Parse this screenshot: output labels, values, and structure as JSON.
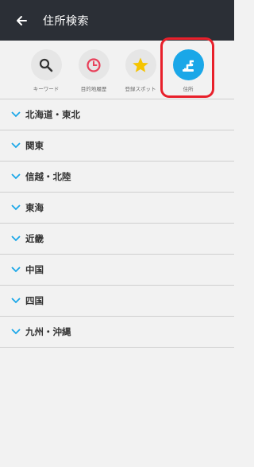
{
  "header": {
    "title": "住所検索"
  },
  "modes": [
    {
      "label": "キーワード",
      "icon": "search-icon"
    },
    {
      "label": "目的地履歴",
      "icon": "clock-icon"
    },
    {
      "label": "登録スポット",
      "icon": "star-icon"
    },
    {
      "label": "住所",
      "icon": "address-icon",
      "active": true
    }
  ],
  "regions": [
    {
      "label": "北海道・東北"
    },
    {
      "label": "関東"
    },
    {
      "label": "信越・北陸"
    },
    {
      "label": "東海"
    },
    {
      "label": "近畿"
    },
    {
      "label": "中国"
    },
    {
      "label": "四国"
    },
    {
      "label": "九州・沖縄"
    }
  ],
  "colors": {
    "header_bg": "#2b2f36",
    "accent": "#1aa7e8",
    "highlight": "#e8202b",
    "clock": "#e8405a",
    "star": "#f5c400"
  }
}
